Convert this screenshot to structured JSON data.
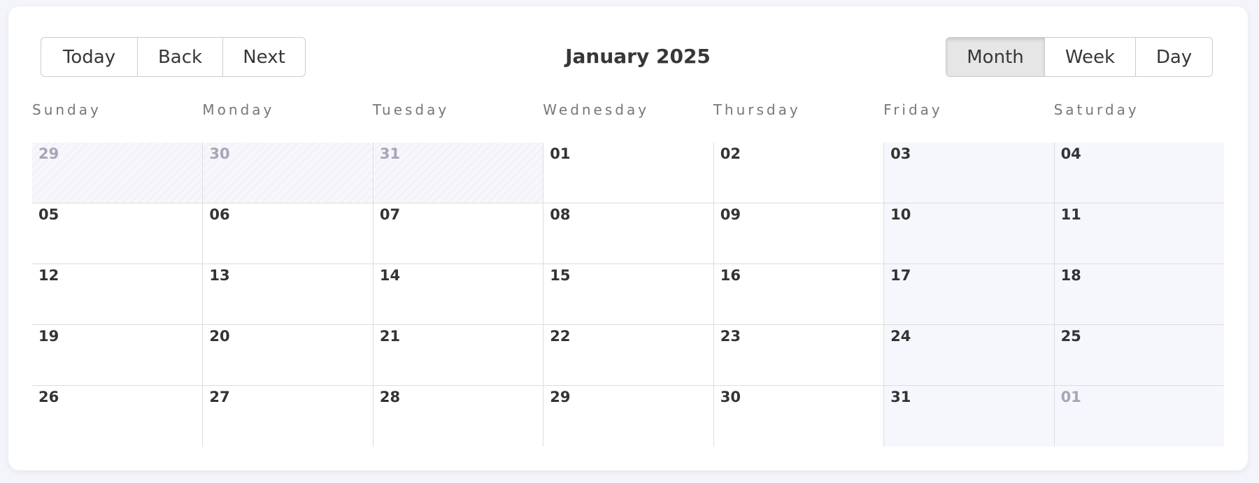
{
  "toolbar": {
    "nav": [
      {
        "name": "today-button",
        "label": "Today",
        "width": 137
      },
      {
        "name": "back-button",
        "label": "Back",
        "width": 122
      },
      {
        "name": "next-button",
        "label": "Next",
        "width": 118
      }
    ],
    "title": "January 2025",
    "views": [
      {
        "name": "month-view-button",
        "label": "Month",
        "active": true
      },
      {
        "name": "week-view-button",
        "label": "Week",
        "active": false
      },
      {
        "name": "day-view-button",
        "label": "Day",
        "active": false
      }
    ]
  },
  "weekdays": [
    "Sunday",
    "Monday",
    "Tuesday",
    "Wednesday",
    "Thursday",
    "Friday",
    "Saturday"
  ],
  "weeks": [
    [
      {
        "day": "29",
        "state": "prev-month"
      },
      {
        "day": "30",
        "state": "prev-month"
      },
      {
        "day": "31",
        "state": "prev-month"
      },
      {
        "day": "01",
        "state": "current"
      },
      {
        "day": "02",
        "state": "current"
      },
      {
        "day": "03",
        "state": "current"
      },
      {
        "day": "04",
        "state": "current"
      }
    ],
    [
      {
        "day": "05",
        "state": "current"
      },
      {
        "day": "06",
        "state": "current"
      },
      {
        "day": "07",
        "state": "current"
      },
      {
        "day": "08",
        "state": "current"
      },
      {
        "day": "09",
        "state": "current"
      },
      {
        "day": "10",
        "state": "current"
      },
      {
        "day": "11",
        "state": "current"
      }
    ],
    [
      {
        "day": "12",
        "state": "current"
      },
      {
        "day": "13",
        "state": "current"
      },
      {
        "day": "14",
        "state": "current"
      },
      {
        "day": "15",
        "state": "current"
      },
      {
        "day": "16",
        "state": "current"
      },
      {
        "day": "17",
        "state": "current"
      },
      {
        "day": "18",
        "state": "current"
      }
    ],
    [
      {
        "day": "19",
        "state": "current"
      },
      {
        "day": "20",
        "state": "current"
      },
      {
        "day": "21",
        "state": "current"
      },
      {
        "day": "22",
        "state": "current"
      },
      {
        "day": "23",
        "state": "current"
      },
      {
        "day": "24",
        "state": "current"
      },
      {
        "day": "25",
        "state": "current"
      }
    ],
    [
      {
        "day": "26",
        "state": "current"
      },
      {
        "day": "27",
        "state": "current"
      },
      {
        "day": "28",
        "state": "current"
      },
      {
        "day": "29",
        "state": "current"
      },
      {
        "day": "30",
        "state": "current"
      },
      {
        "day": "31",
        "state": "current"
      },
      {
        "day": "01",
        "state": "next-month"
      }
    ]
  ],
  "colors": {
    "page_background": "#f4f5fb",
    "card_background": "#ffffff",
    "weekend_background": "#f6f7fc",
    "off_range_text": "#a6a6b8",
    "active_button": "#e6e6e6",
    "border": "#cccccc"
  }
}
